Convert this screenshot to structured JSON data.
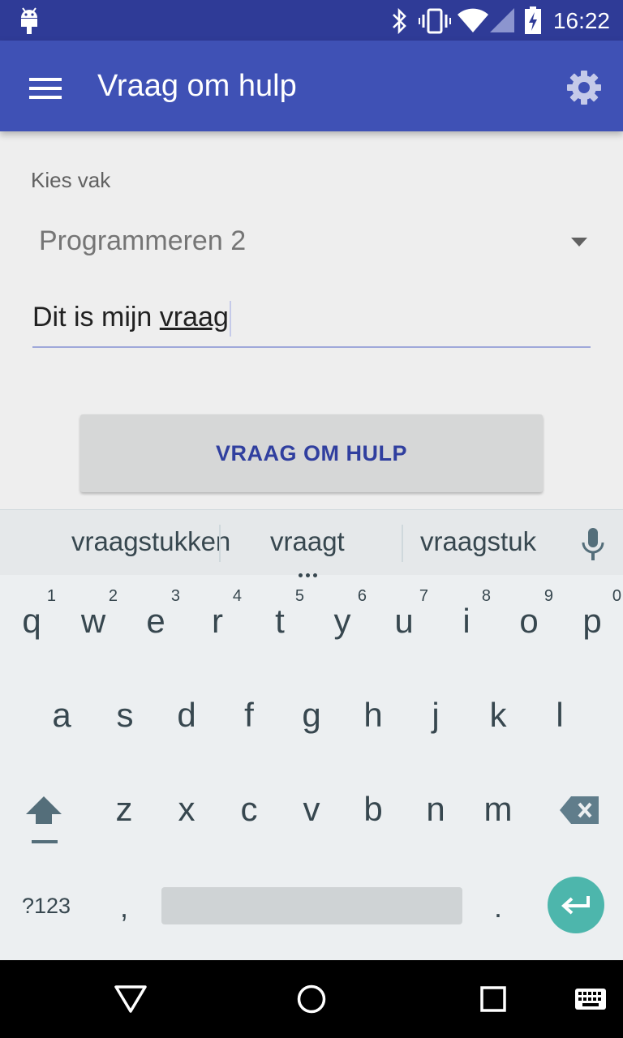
{
  "status_bar": {
    "time": "16:22"
  },
  "app_bar": {
    "title": "Vraag om hulp"
  },
  "form": {
    "subject_label": "Kies vak",
    "subject_selected": "Programmeren 2",
    "question_prefix": "Dit is mijn ",
    "question_underlined_word": "vraag",
    "submit_label": "VRAAG OM HULP"
  },
  "keyboard": {
    "suggestions": [
      "vraagstukken",
      "vraagt",
      "vraagstuk"
    ],
    "row1": [
      {
        "letter": "q",
        "num": "1"
      },
      {
        "letter": "w",
        "num": "2"
      },
      {
        "letter": "e",
        "num": "3"
      },
      {
        "letter": "r",
        "num": "4"
      },
      {
        "letter": "t",
        "num": "5"
      },
      {
        "letter": "y",
        "num": "6"
      },
      {
        "letter": "u",
        "num": "7"
      },
      {
        "letter": "i",
        "num": "8"
      },
      {
        "letter": "o",
        "num": "9"
      },
      {
        "letter": "p",
        "num": "0"
      }
    ],
    "row2": [
      "a",
      "s",
      "d",
      "f",
      "g",
      "h",
      "j",
      "k",
      "l"
    ],
    "row3": [
      "z",
      "x",
      "c",
      "v",
      "b",
      "n",
      "m"
    ],
    "symbols_label": "?123",
    "comma": ",",
    "period": "."
  },
  "colors": {
    "status_bar": "#2f3b97",
    "app_bar": "#3f51b5",
    "accent_text": "#303f9f",
    "enter_key": "#4db6ac"
  }
}
